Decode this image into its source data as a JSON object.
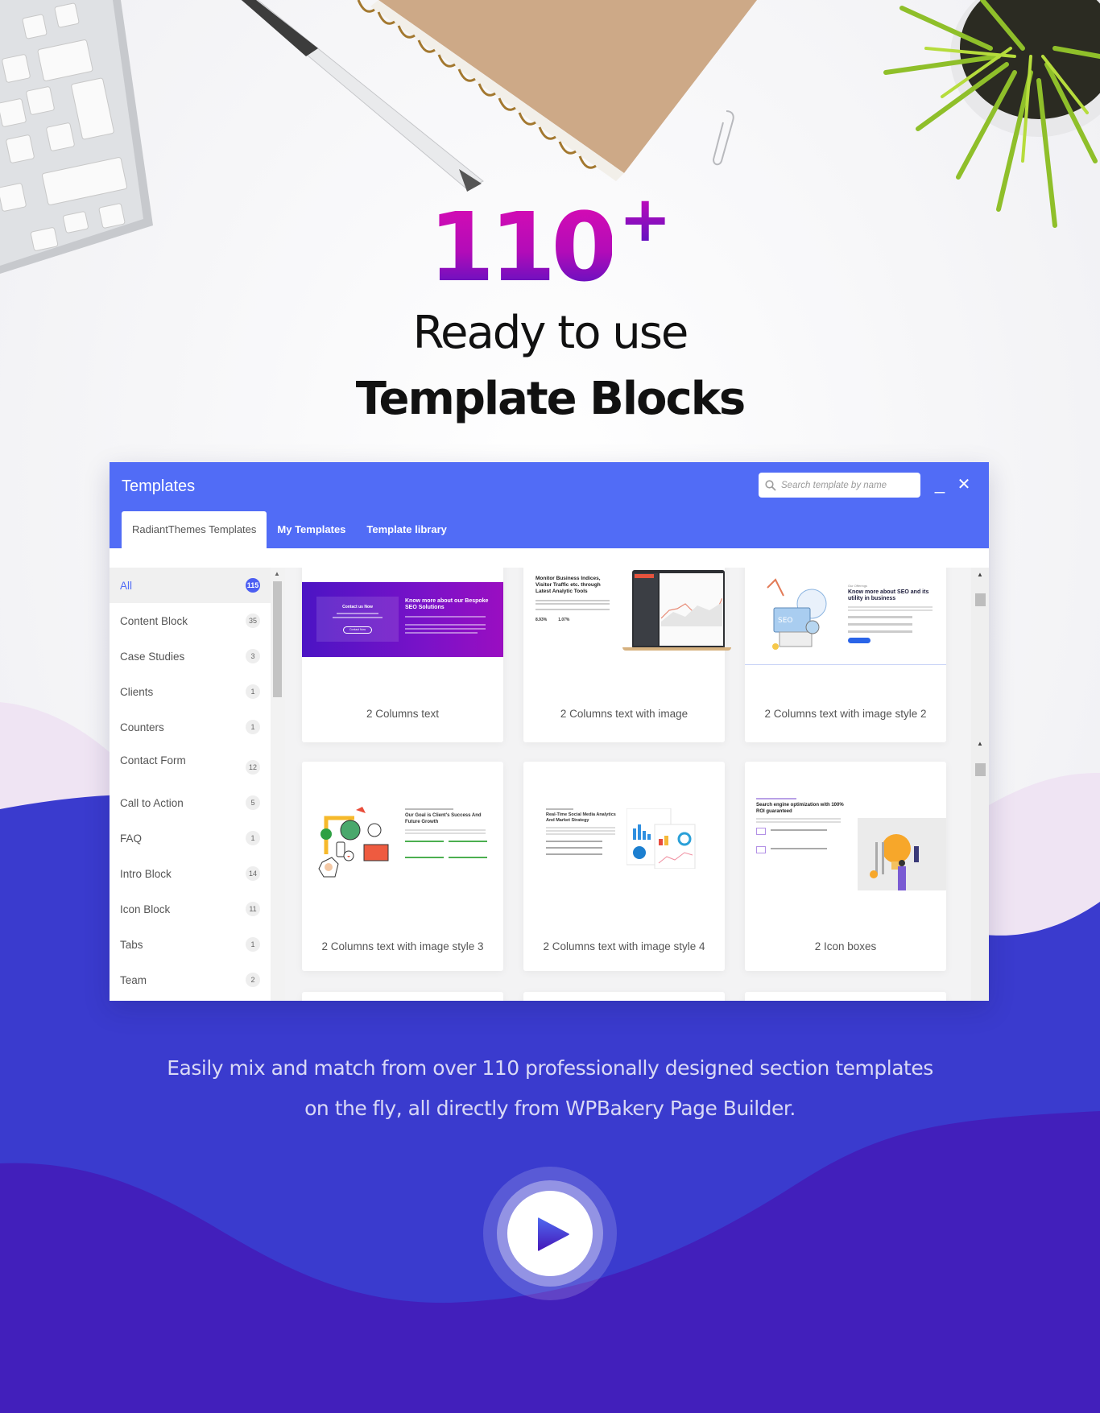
{
  "hero": {
    "number": "110",
    "superscript": "+",
    "subtitle": "Ready to use",
    "title": "Template Blocks"
  },
  "window": {
    "title": "Templates",
    "search": {
      "placeholder": "Search template by name",
      "value": ""
    },
    "minimize_label": "_",
    "close_label": "✕",
    "tabs": [
      {
        "label": "RadiantThemes Templates",
        "active": true
      },
      {
        "label": "My Templates",
        "active": false
      },
      {
        "label": "Template library",
        "active": false
      }
    ],
    "categories": [
      {
        "label": "All",
        "count": "115",
        "active": true
      },
      {
        "label": "Content Block",
        "count": "35"
      },
      {
        "label": "Case Studies",
        "count": "3"
      },
      {
        "label": "Clients",
        "count": "1"
      },
      {
        "label": "Counters",
        "count": "1"
      },
      {
        "label": "Contact Form",
        "count": "12"
      },
      {
        "label": "Call to Action",
        "count": "5"
      },
      {
        "label": "FAQ",
        "count": "1"
      },
      {
        "label": "Intro Block",
        "count": "14"
      },
      {
        "label": "Icon Block",
        "count": "11"
      },
      {
        "label": "Tabs",
        "count": "1"
      },
      {
        "label": "Team",
        "count": "2"
      }
    ],
    "templates": [
      {
        "name": "2 Columns text",
        "preview": {
          "left_heading": "Contact us Now",
          "left_button": "Contact Now",
          "right_heading": "Know more about our Bespoke SEO Solutions"
        }
      },
      {
        "name": "2 Columns text with image",
        "preview": {
          "heading": "Monitor Business Indices, Visitor Traffic etc. through Latest Analytic Tools",
          "stat1": "8.93%",
          "stat2": "1.07%"
        }
      },
      {
        "name": "2 Columns text with image style 2",
        "preview": {
          "kicker": "Our Offerings",
          "heading": "Know more about SEO and its utility in business",
          "badge": "SEO"
        }
      },
      {
        "name": "2 Columns text with image style 3",
        "preview": {
          "heading": "Our Goal is Client's Success And Future Growth"
        }
      },
      {
        "name": "2 Columns text with image style 4",
        "preview": {
          "heading": "Real-Time Social Media Analytics And Market Strategy"
        }
      },
      {
        "name": "2 Icon boxes",
        "preview": {
          "heading": "Search engine optimization with 100% ROI guaranteed"
        }
      }
    ]
  },
  "tagline": {
    "line1": "Easily mix and match from over 110 professionally designed section templates",
    "line2": "on the fly, all directly from WPBakery Page Builder."
  },
  "colors": {
    "accent": "#516cf6",
    "hero_gradient_top": "#d90bb3",
    "hero_gradient_bottom": "#5012c2",
    "band_blue": "#3a3bce",
    "band_deep": "#421fbb",
    "lavender": "#efe4f3"
  }
}
